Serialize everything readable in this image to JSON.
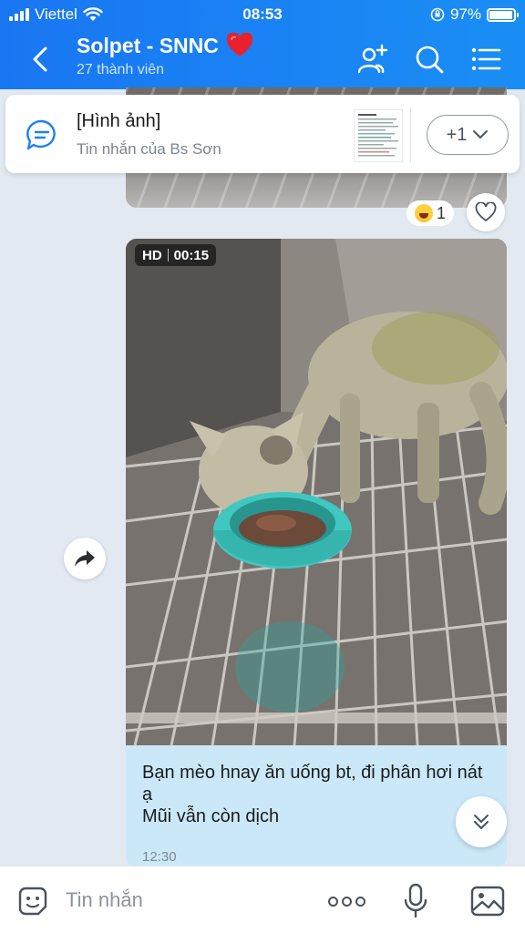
{
  "status_bar": {
    "carrier": "Viettel",
    "time": "08:53",
    "battery": "97%",
    "battery_level": 0.97
  },
  "header": {
    "title": "Solpet - SNNC",
    "subtitle": "27 thành viên",
    "icons": [
      "back-icon",
      "add-member-icon",
      "search-icon",
      "menu-icon"
    ]
  },
  "pinned": {
    "title": "[Hình ảnh]",
    "subtitle": "Tin nhắn của Bs Sơn",
    "more_label": "+1"
  },
  "previous_message": {
    "reaction_count": "1",
    "reaction_icon": "laughing-emoji-icon"
  },
  "video_message": {
    "quality": "HD",
    "duration": "00:15",
    "caption_line1": "Bạn mèo hnay ăn uống bt, đi phân hơi nát ạ",
    "caption_line2": "Mũi vẫn còn dịch",
    "time": "12:30"
  },
  "input_bar": {
    "placeholder": "Tin nhắn"
  },
  "colors": {
    "header_bg": "#1a82f3",
    "bubble_bg": "#cbe8f8",
    "chat_bg": "#e2e9f1"
  }
}
